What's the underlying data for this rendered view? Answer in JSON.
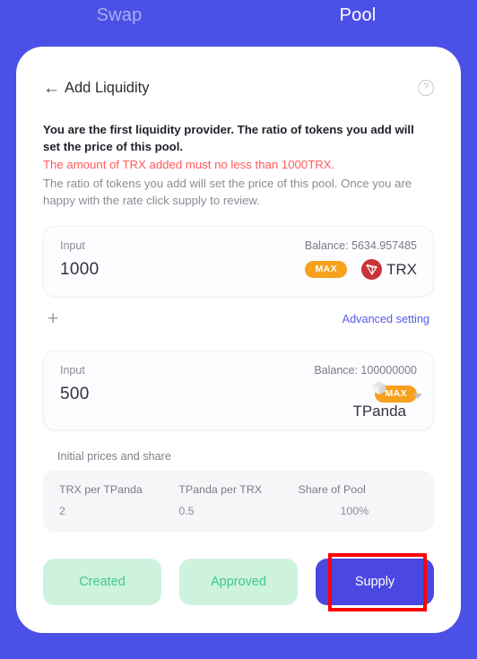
{
  "tabs": [
    {
      "label": "Swap",
      "active": false
    },
    {
      "label": "Pool",
      "active": true
    }
  ],
  "card": {
    "back_icon": "←",
    "title": "Add Liquidity",
    "help_icon": "?"
  },
  "notices": {
    "bold": "You are the first liquidity provider. The ratio of tokens you add will set the price of this pool.",
    "warning": "The amount of TRX added must no less than 1000TRX.",
    "muted": "The ratio of tokens you add will set the price of this pool. Once you are happy with the rate click supply to review."
  },
  "inputs": [
    {
      "label": "Input",
      "balance": "Balance: 5634.957485",
      "amount": "1000",
      "max_label": "MAX",
      "token": "TRX",
      "token_icon": "trx-logo"
    },
    {
      "label": "Input",
      "balance": "Balance: 100000000",
      "amount": "500",
      "max_label": "MAX",
      "token": "TPanda",
      "token_icon": "cube-placeholder-icon"
    }
  ],
  "mid_row": {
    "plus_icon": "+",
    "advanced_link": "Advanced setting"
  },
  "prices": {
    "section_label": "Initial prices and share",
    "columns": [
      {
        "header": "TRX per TPanda",
        "value": "2"
      },
      {
        "header": "TPanda per TRX",
        "value": "0.5"
      },
      {
        "header": "Share of Pool",
        "value": "100%"
      }
    ]
  },
  "actions": [
    {
      "label": "Created",
      "state": "done"
    },
    {
      "label": "Approved",
      "state": "done"
    },
    {
      "label": "Supply",
      "state": "primary",
      "highlighted": true
    }
  ],
  "colors": {
    "background_blue": "#4b50e6",
    "primary_button": "#4a48e0",
    "done_button_bg": "#cdf2de",
    "done_button_text": "#3fc98c",
    "max_badge": "#f7a01e",
    "warning_text": "#ff5a5a",
    "link": "#5a5ae8",
    "highlight_outline": "#ff0000",
    "trx_logo": "#c8333a"
  }
}
